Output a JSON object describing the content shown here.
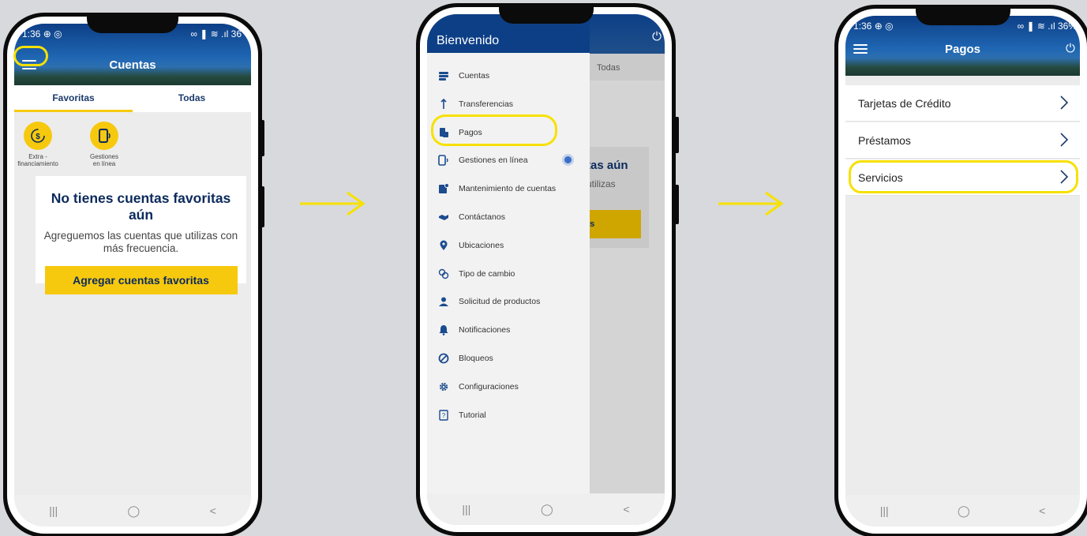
{
  "colors": {
    "accent_yellow": "#f6c90e",
    "brand_blue": "#0d3f86",
    "highlight": "#f7e100"
  },
  "screen1": {
    "status_time": "1:36",
    "status_icons": "⊕ ◎",
    "status_sys": "∞ ❚ ≋ .ıl 36",
    "title": "Cuentas",
    "tabs": [
      "Favoritas",
      "Todas"
    ],
    "quick_actions": [
      {
        "label_line1": "Extra -",
        "label_line2": "financiamiento",
        "icon": "money-cycle-icon"
      },
      {
        "label_line1": "Gestiones",
        "label_line2": "en línea",
        "icon": "phone-signal-icon"
      }
    ],
    "empty_title": "No tienes cuentas favoritas aún",
    "empty_text": "Agreguemos las cuentas que utilizas con más frecuencia.",
    "button": "Agregar cuentas favoritas",
    "nav": [
      "|||",
      "◯",
      "<"
    ]
  },
  "screen2": {
    "drawer_title": "Bienvenido",
    "bg_tab": "Todas",
    "bg_text1": "tas aún",
    "bg_text2": "utilizas",
    "bg_button": "as",
    "menu": [
      {
        "label": "Cuentas",
        "icon": "accounts-icon"
      },
      {
        "label": "Transferencias",
        "icon": "transfer-icon"
      },
      {
        "label": "Pagos",
        "icon": "payments-icon"
      },
      {
        "label": "Gestiones en línea",
        "icon": "online-icon"
      },
      {
        "label": "Mantenimiento de cuentas",
        "icon": "maintenance-icon"
      },
      {
        "label": "Contáctanos",
        "icon": "handshake-icon"
      },
      {
        "label": "Ubicaciones",
        "icon": "location-pin-icon"
      },
      {
        "label": "Tipo de cambio",
        "icon": "exchange-icon"
      },
      {
        "label": "Solicitud de productos",
        "icon": "user-request-icon"
      },
      {
        "label": "Notificaciones",
        "icon": "bell-icon"
      },
      {
        "label": "Bloqueos",
        "icon": "block-icon"
      },
      {
        "label": "Configuraciones",
        "icon": "gear-icon"
      },
      {
        "label": "Tutorial",
        "icon": "tutorial-icon"
      }
    ],
    "nav": [
      "|||",
      "◯",
      "<"
    ]
  },
  "screen3": {
    "status_time": "1:36",
    "status_icons": "⊕ ◎",
    "status_sys": "∞ ❚ ≋ .ıl 36%",
    "title": "Pagos",
    "rows": [
      "Tarjetas de Crédito",
      "Préstamos",
      "Servicios"
    ],
    "nav": [
      "|||",
      "◯",
      "<"
    ]
  }
}
